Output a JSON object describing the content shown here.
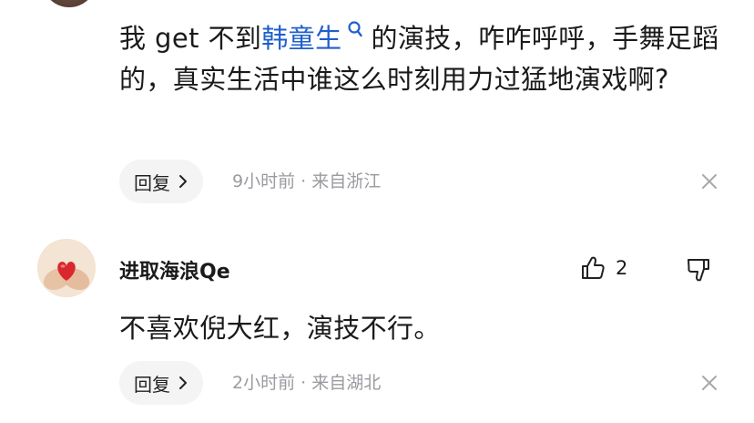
{
  "comment1": {
    "text_before": "我 get 不到",
    "link_text": "韩童生",
    "text_after": "的演技，咋咋呼呼，手舞足蹈的，真实生活中谁这么时刻用力过猛地演戏啊?",
    "reply_label": "回复",
    "meta": "9小时前 · 来自浙江"
  },
  "comment2": {
    "username": "进取海浪Qe",
    "like_count": "2",
    "text": "不喜欢倪大红，演技不行。",
    "reply_label": "回复",
    "meta": "2小时前 · 来自湖北"
  },
  "colors": {
    "link": "#1f5fcc",
    "muted": "#9a9aa0",
    "pill_bg": "#f4f4f5"
  },
  "icons": [
    "search-icon",
    "chevron-right-icon",
    "close-icon",
    "thumbs-up-icon",
    "thumbs-down-icon"
  ]
}
